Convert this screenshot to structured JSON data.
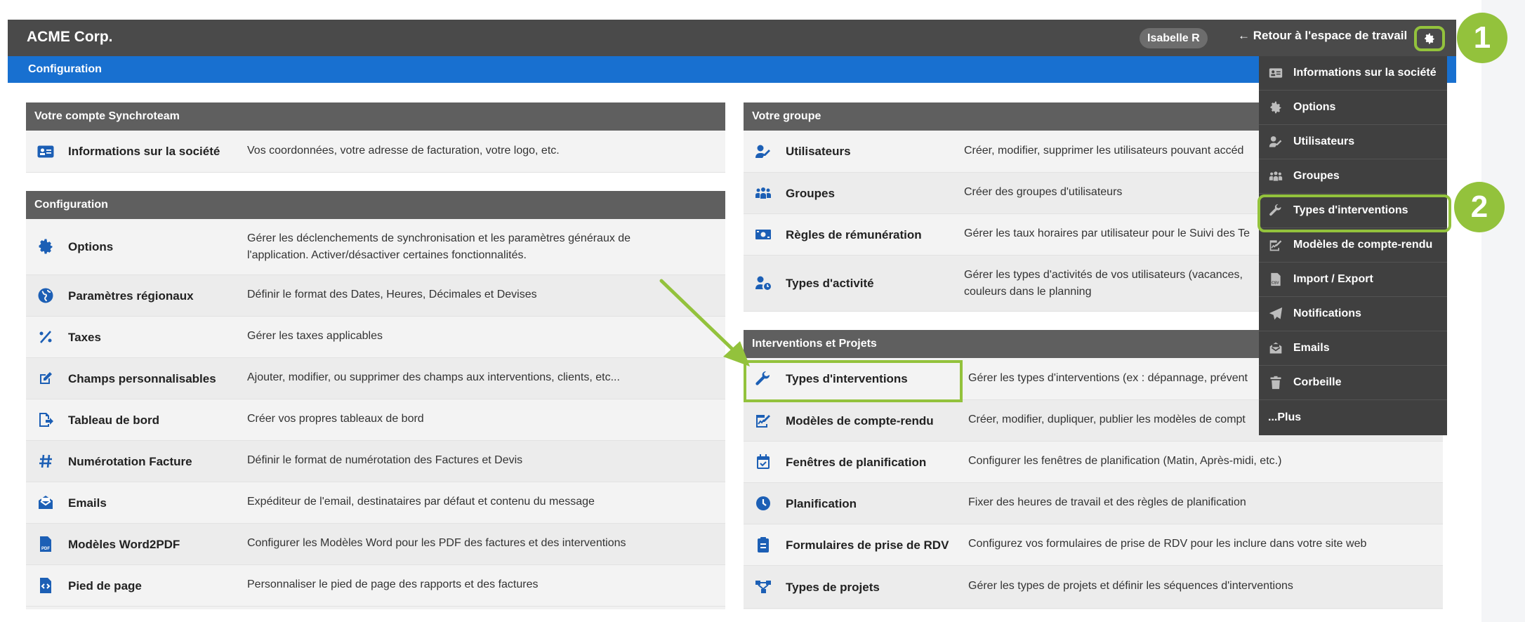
{
  "topbar": {
    "brand": "ACME Corp.",
    "user": "Isabelle R",
    "back_link": "← Retour à l'espace de travail"
  },
  "subbar": {
    "title": "Configuration"
  },
  "compte": {
    "header": "Votre compte Synchroteam",
    "rows": [
      {
        "icon": "id-card-icon",
        "title": "Informations sur la société",
        "desc": "Vos coordonnées, votre adresse de facturation, votre logo, etc."
      }
    ]
  },
  "config": {
    "header": "Configuration",
    "rows": [
      {
        "icon": "gear-icon",
        "title": "Options",
        "desc": "Gérer les déclenchements de synchronisation et les paramètres généraux de l'application. Activer/désactiver certaines fonctionnalités."
      },
      {
        "icon": "globe-icon",
        "title": "Paramètres régionaux",
        "desc": "Définir le format des Dates, Heures, Décimales et Devises"
      },
      {
        "icon": "percent-icon",
        "title": "Taxes",
        "desc": "Gérer les taxes applicables"
      },
      {
        "icon": "edit-icon",
        "title": "Champs personnalisables",
        "desc": "Ajouter, modifier, ou supprimer des champs aux interventions, clients, etc..."
      },
      {
        "icon": "dashboard-icon",
        "title": "Tableau de bord",
        "desc": "Créer vos propres tableaux de bord"
      },
      {
        "icon": "hash-icon",
        "title": "Numérotation Facture",
        "desc": "Définir le format de numérotation des Factures et Devis"
      },
      {
        "icon": "email-icon",
        "title": "Emails",
        "desc": "Expéditeur de l'email, destinataires par défaut et contenu du message"
      },
      {
        "icon": "pdf-icon",
        "title": "Modèles Word2PDF",
        "desc": "Configurer les Modèles Word pour les PDF des factures et des interventions"
      },
      {
        "icon": "code-file-icon",
        "title": "Pied de page",
        "desc": "Personnaliser le pied de page des rapports et des factures"
      }
    ]
  },
  "groupe": {
    "header": "Votre groupe",
    "rows": [
      {
        "icon": "user-edit-icon",
        "title": "Utilisateurs",
        "desc": "Créer, modifier, supprimer les utilisateurs pouvant accéd"
      },
      {
        "icon": "users-icon",
        "title": "Groupes",
        "desc": "Créer des groupes d'utilisateurs"
      },
      {
        "icon": "money-icon",
        "title": "Règles de rémunération",
        "desc": "Gérer les taux horaires par utilisateur pour le Suivi des Te"
      },
      {
        "icon": "user-clock-icon",
        "title": "Types d'activité",
        "desc": "Gérer les types d'activités de vos utilisateurs (vacances, couleurs dans le planning"
      }
    ]
  },
  "interventions": {
    "header": "Interventions et Projets",
    "rows": [
      {
        "icon": "wrench-icon",
        "title": "Types d'interventions",
        "desc": "Gérer les types d'interventions (ex : dépannage, prévent"
      },
      {
        "icon": "report-edit-icon",
        "title": "Modèles de compte-rendu",
        "desc": "Créer, modifier, dupliquer, publier les modèles de compt"
      },
      {
        "icon": "calendar-check-icon",
        "title": "Fenêtres de planification",
        "desc": "Configurer les fenêtres de planification (Matin, Après-midi, etc.)"
      },
      {
        "icon": "clock-icon",
        "title": "Planification",
        "desc": "Fixer des heures de travail et des règles de planification"
      },
      {
        "icon": "clipboard-icon",
        "title": "Formulaires de prise de RDV",
        "desc": "Configurez vos formulaires de prise de RDV pour les inclure dans votre site web"
      },
      {
        "icon": "project-tree-icon",
        "title": "Types de projets",
        "desc": "Gérer les types de projets et définir les séquences d'interventions"
      }
    ]
  },
  "dropdown": {
    "items": [
      {
        "icon": "id-card-icon",
        "label": "Informations sur la société"
      },
      {
        "icon": "gear-icon",
        "label": "Options"
      },
      {
        "icon": "user-edit-icon",
        "label": "Utilisateurs"
      },
      {
        "icon": "users-icon",
        "label": "Groupes"
      },
      {
        "icon": "wrench-icon",
        "label": "Types d'interventions"
      },
      {
        "icon": "report-edit-icon",
        "label": "Modèles de compte-rendu"
      },
      {
        "icon": "csv-file-icon",
        "label": "Import / Export"
      },
      {
        "icon": "paper-plane-icon",
        "label": "Notifications"
      },
      {
        "icon": "email-icon",
        "label": "Emails"
      },
      {
        "icon": "trash-icon",
        "label": "Corbeille"
      }
    ],
    "more": "...Plus"
  },
  "annotations": {
    "badge1": "1",
    "badge2": "2"
  },
  "colors": {
    "accent_green": "#93c23c",
    "icon_blue": "#1c5fb5",
    "subbar_blue": "#1870d0",
    "topbar": "#4a4a4a"
  }
}
